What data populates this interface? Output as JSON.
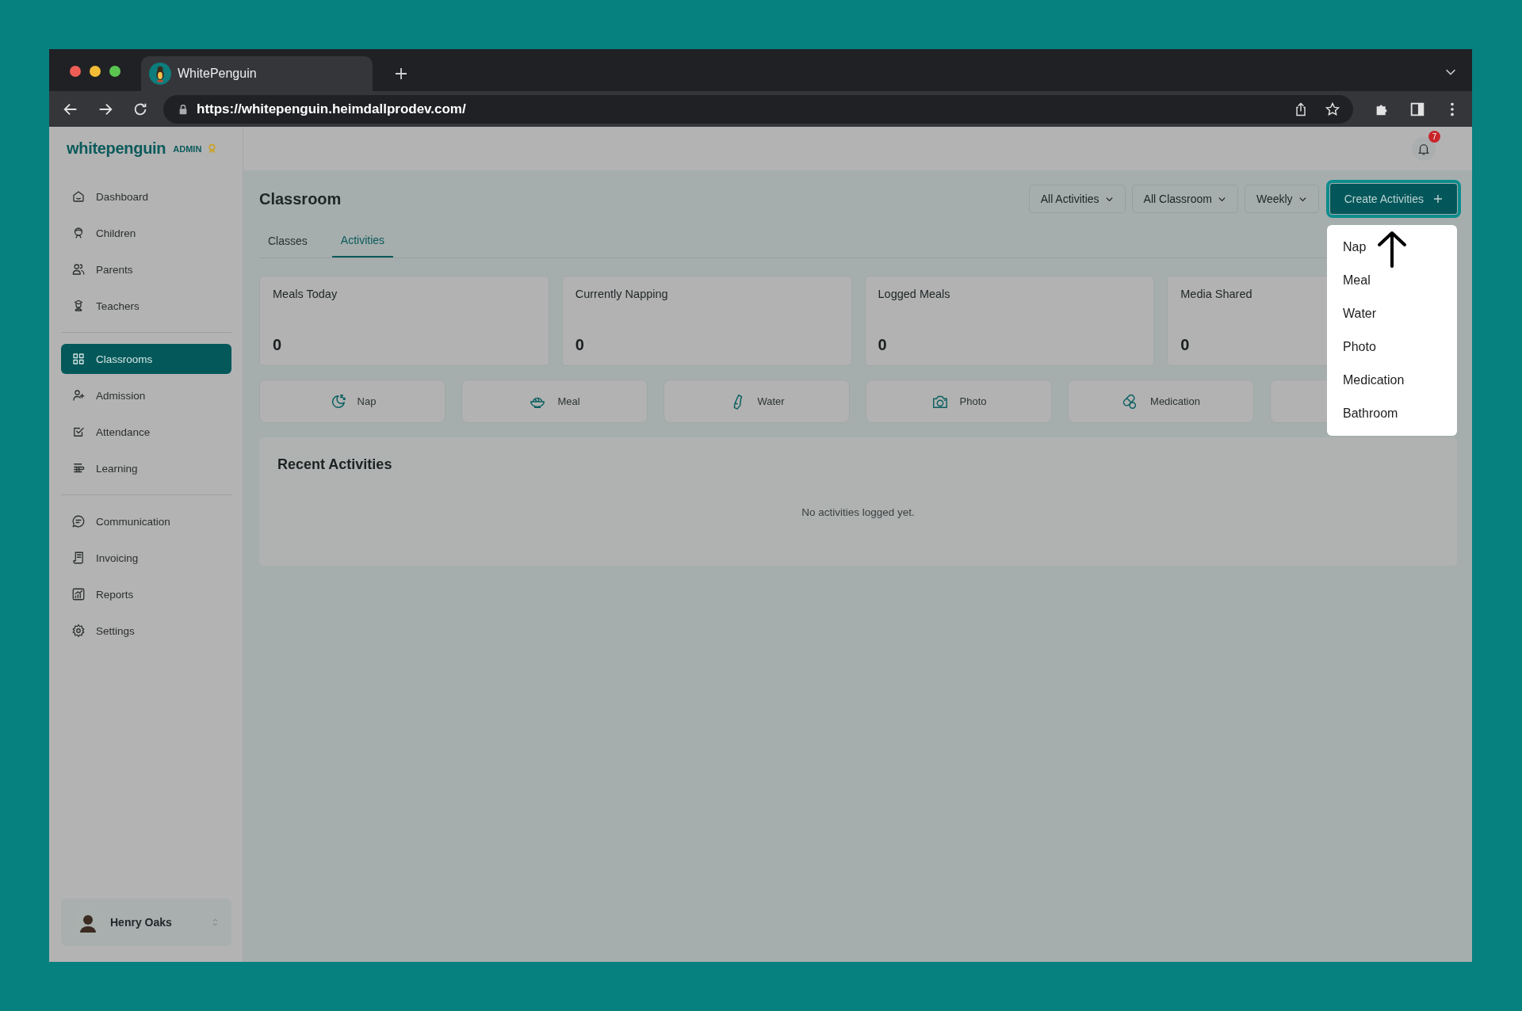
{
  "browser": {
    "tab_title": "WhitePenguin",
    "url": "https://whitepenguin.heimdallprodev.com/"
  },
  "sidebar": {
    "logo": "whitepenguin",
    "role": "ADMIN",
    "groups": [
      [
        {
          "label": "Dashboard",
          "kind": "home",
          "selected": false
        },
        {
          "label": "Children",
          "kind": "child",
          "selected": false
        },
        {
          "label": "Parents",
          "kind": "people",
          "selected": false
        },
        {
          "label": "Teachers",
          "kind": "teacher",
          "selected": false
        }
      ],
      [
        {
          "label": "Classrooms",
          "kind": "grid",
          "selected": true
        },
        {
          "label": "Admission",
          "kind": "adduser",
          "selected": false
        },
        {
          "label": "Attendance",
          "kind": "check",
          "selected": false
        },
        {
          "label": "Learning",
          "kind": "learn",
          "selected": false
        }
      ],
      [
        {
          "label": "Communication",
          "kind": "chat",
          "selected": false
        },
        {
          "label": "Invoicing",
          "kind": "invoice",
          "selected": false
        },
        {
          "label": "Reports",
          "kind": "chart",
          "selected": false
        },
        {
          "label": "Settings",
          "kind": "gear",
          "selected": false
        }
      ]
    ],
    "user": {
      "name": "Henry Oaks"
    }
  },
  "header": {
    "notification_count": "7"
  },
  "page": {
    "title": "Classroom",
    "tabs": [
      {
        "label": "Classes",
        "selected": false
      },
      {
        "label": "Activities",
        "selected": true
      }
    ],
    "filters": [
      "All Activities",
      "All Classroom",
      "Weekly"
    ],
    "create_button": "Create Activities",
    "menu": [
      "Nap",
      "Meal",
      "Water",
      "Photo",
      "Medication",
      "Bathroom"
    ],
    "stats": [
      {
        "label": "Meals Today",
        "value": "0"
      },
      {
        "label": "Currently Napping",
        "value": "0"
      },
      {
        "label": "Logged Meals",
        "value": "0"
      },
      {
        "label": "Media Shared",
        "value": "0"
      }
    ],
    "actions": [
      {
        "label": "Nap",
        "kind": "moon"
      },
      {
        "label": "Meal",
        "kind": "bowl"
      },
      {
        "label": "Water",
        "kind": "bottle"
      },
      {
        "label": "Photo",
        "kind": "camera"
      },
      {
        "label": "Medication",
        "kind": "pill"
      }
    ],
    "recent": {
      "title": "Recent Activities",
      "empty": "No activities logged yet."
    }
  }
}
